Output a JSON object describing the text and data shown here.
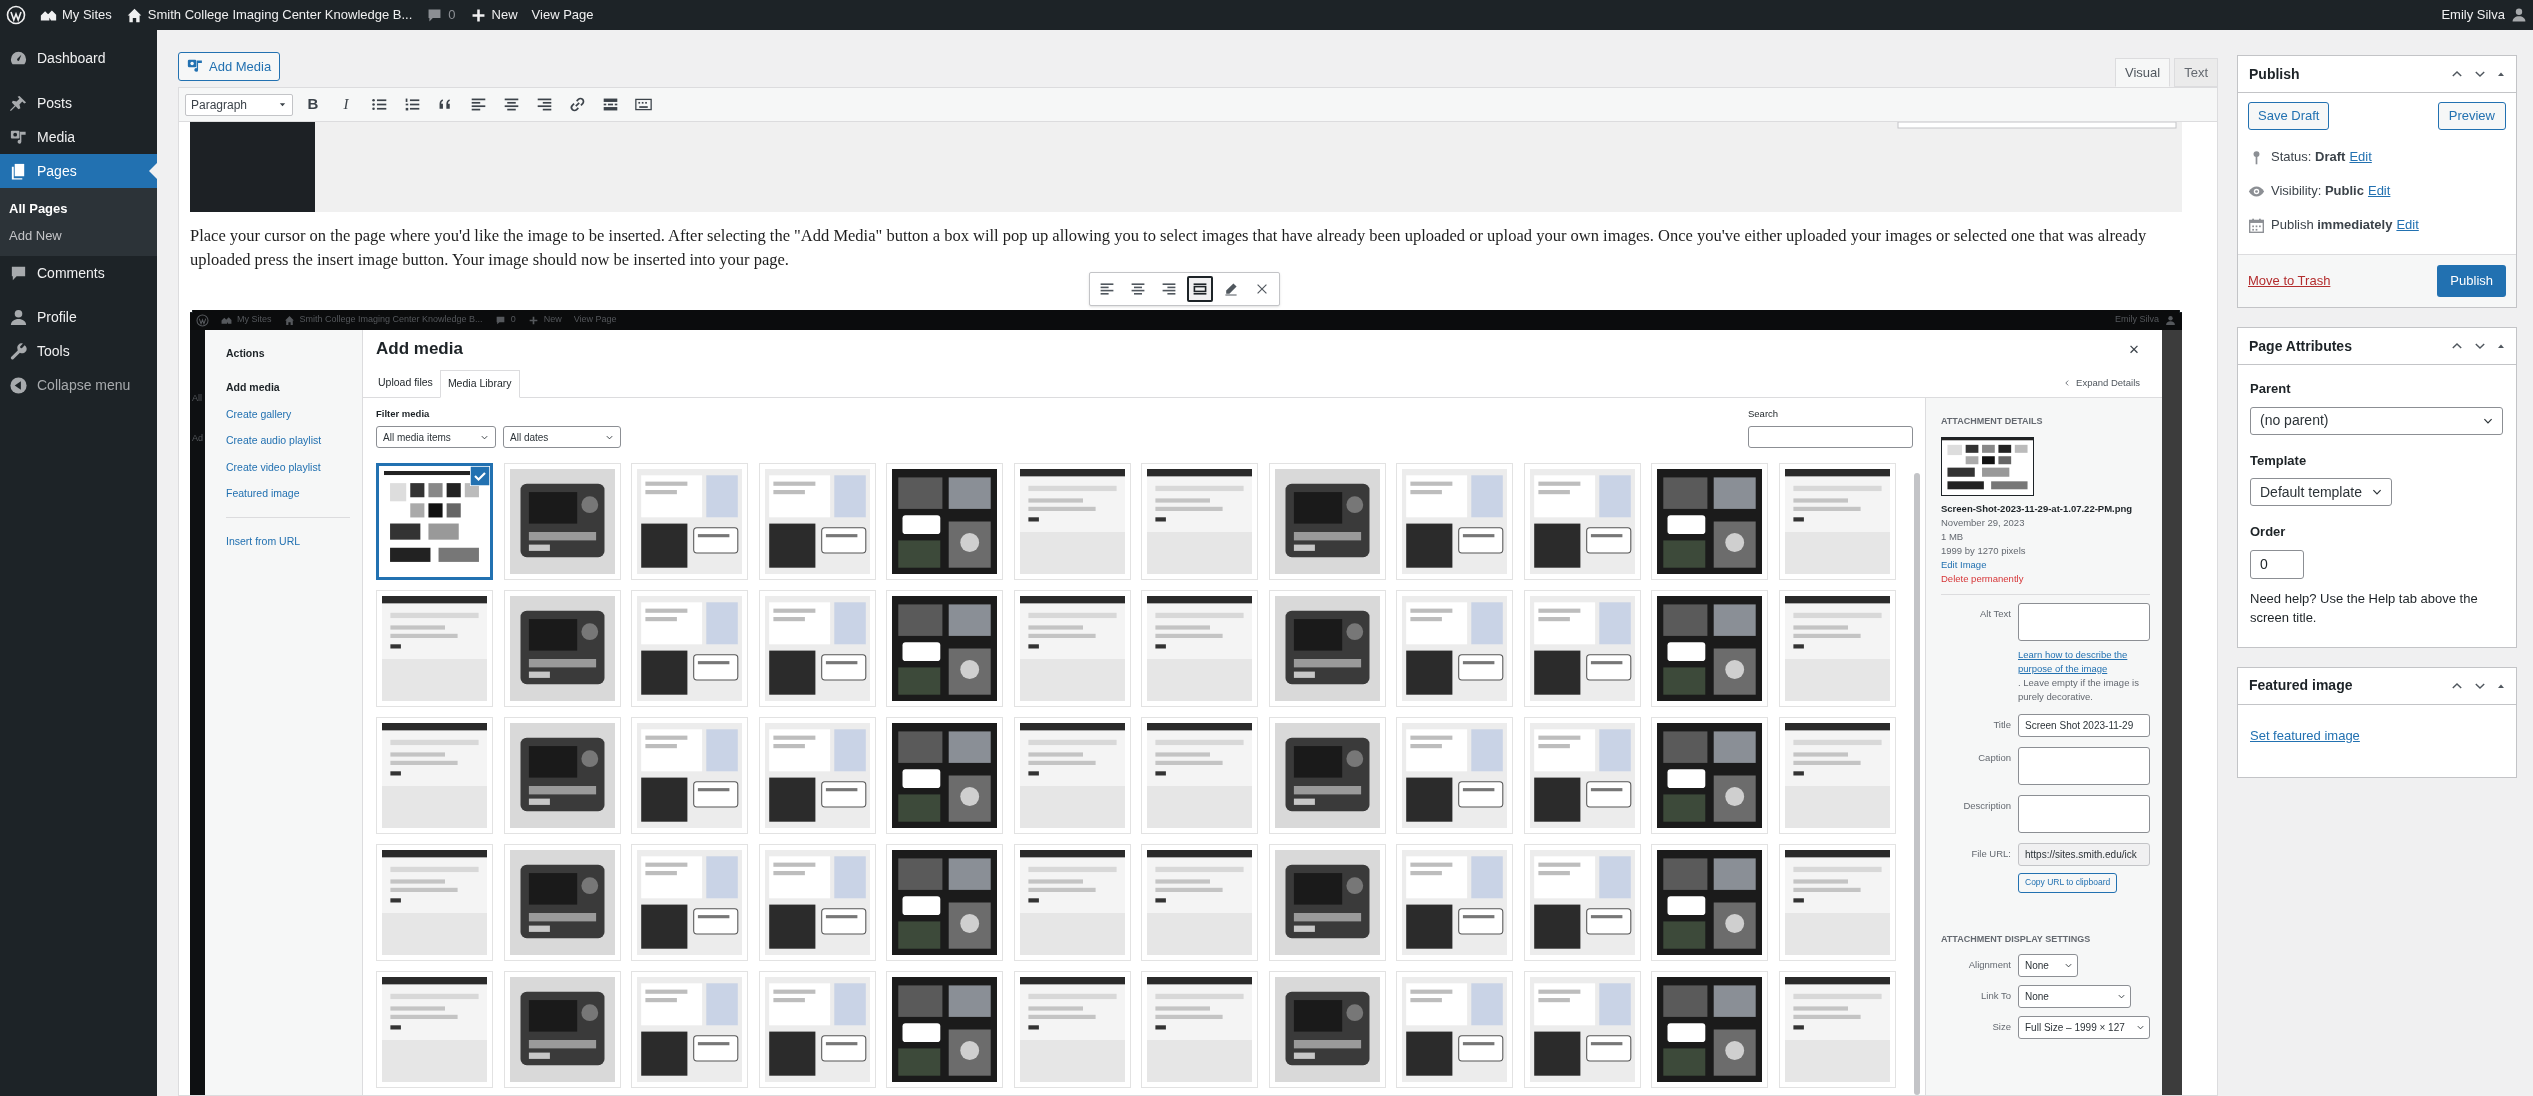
{
  "admin_bar": {
    "items": [
      {
        "kind": "sites",
        "label": "My Sites"
      },
      {
        "kind": "site",
        "label": "Smith College Imaging Center Knowledge B..."
      },
      {
        "kind": "comments",
        "label": "0"
      },
      {
        "kind": "new",
        "label": "New"
      },
      {
        "kind": "view",
        "label": "View Page"
      }
    ],
    "user": "Emily Silva"
  },
  "sidebar": {
    "items": [
      {
        "kind": "dashboard",
        "label": "Dashboard",
        "selected": false
      },
      {
        "kind": "posts",
        "label": "Posts",
        "selected": false
      },
      {
        "kind": "media",
        "label": "Media",
        "selected": false
      },
      {
        "kind": "pages",
        "label": "Pages",
        "selected": true,
        "children": [
          {
            "label": "All Pages",
            "selected": true
          },
          {
            "label": "Add New",
            "selected": false
          }
        ]
      },
      {
        "kind": "comments",
        "label": "Comments",
        "selected": false
      },
      {
        "kind": "profile",
        "label": "Profile",
        "selected": false
      },
      {
        "kind": "tools",
        "label": "Tools",
        "selected": false
      },
      {
        "kind": "collapse",
        "label": "Collapse menu",
        "selected": false
      }
    ]
  },
  "editor": {
    "add_media": "Add Media",
    "tabs": [
      {
        "label": "Visual",
        "selected": true
      },
      {
        "label": "Text",
        "selected": false
      }
    ],
    "format": "Paragraph",
    "toolbar": [
      {
        "kind": "bold",
        "label": "B"
      },
      {
        "kind": "italic",
        "label": "I"
      },
      {
        "kind": "bullets"
      },
      {
        "kind": "numbers"
      },
      {
        "kind": "quote"
      },
      {
        "kind": "align-left"
      },
      {
        "kind": "align-center"
      },
      {
        "kind": "align-right"
      },
      {
        "kind": "link"
      },
      {
        "kind": "more"
      },
      {
        "kind": "keyboard"
      }
    ],
    "paragraph": "Place your cursor on the page where you'd like the image to be inserted. After selecting the \"Add Media\" button a box will pop up allowing you to select images that have already been uploaded or upload your own images. Once you've either uploaded your images or selected one that was already uploaded press the insert image button. Your image should now be inserted into your page.",
    "image_toolbar": [
      {
        "kind": "align-left",
        "selected": false
      },
      {
        "kind": "align-center",
        "selected": false
      },
      {
        "kind": "align-right",
        "selected": false
      },
      {
        "kind": "align-none",
        "selected": true
      },
      {
        "kind": "edit",
        "selected": false
      },
      {
        "kind": "remove",
        "selected": false
      }
    ]
  },
  "embedded": {
    "admin_bar": {
      "items": [
        {
          "kind": "sites",
          "label": "My Sites"
        },
        {
          "kind": "site",
          "label": "Smith College Imaging Center Knowledge B..."
        },
        {
          "kind": "comments",
          "label": "0"
        },
        {
          "kind": "new",
          "label": "New"
        },
        {
          "kind": "view",
          "label": "View Page"
        }
      ],
      "user": "Emily Silva"
    },
    "sidebar_fragments": [
      "All",
      "Ad"
    ],
    "modal": {
      "menu_title": "Actions",
      "menu": [
        {
          "label": "Add media",
          "selected": true
        },
        {
          "label": "Create gallery",
          "selected": false
        },
        {
          "label": "Create audio playlist",
          "selected": false
        },
        {
          "label": "Create video playlist",
          "selected": false
        },
        {
          "label": "Featured image",
          "selected": false
        }
      ],
      "extra_menu": [
        {
          "label": "Insert from URL",
          "selected": false
        }
      ],
      "title": "Add media",
      "tabs": [
        {
          "label": "Upload files",
          "selected": false
        },
        {
          "label": "Media Library",
          "selected": true
        }
      ],
      "expand_details": "Expand Details",
      "filter_label": "Filter media",
      "filters": [
        "All media items",
        "All dates"
      ],
      "search_label": "Search",
      "thumbnails": [
        {
          "selected": true
        },
        {
          "selected": false
        },
        {
          "selected": false
        },
        {
          "selected": false
        },
        {
          "selected": false
        },
        {
          "selected": false
        },
        {
          "selected": false
        },
        {
          "selected": false
        },
        {
          "selected": false
        },
        {
          "selected": false
        },
        {
          "selected": false
        },
        {
          "selected": false
        },
        {
          "selected": false
        },
        {
          "selected": false
        },
        {
          "selected": false
        },
        {
          "selected": false
        },
        {
          "selected": false
        },
        {
          "selected": false
        },
        {
          "selected": false
        },
        {
          "selected": false
        },
        {
          "selected": false
        },
        {
          "selected": false
        },
        {
          "selected": false
        },
        {
          "selected": false
        },
        {
          "selected": false
        },
        {
          "selected": false
        },
        {
          "selected": false
        },
        {
          "selected": false
        },
        {
          "selected": false
        },
        {
          "selected": false
        },
        {
          "selected": false
        },
        {
          "selected": false
        },
        {
          "selected": false
        },
        {
          "selected": false
        },
        {
          "selected": false
        },
        {
          "selected": false
        },
        {
          "selected": false
        },
        {
          "selected": false
        },
        {
          "selected": false
        },
        {
          "selected": false
        },
        {
          "selected": false
        },
        {
          "selected": false
        },
        {
          "selected": false
        },
        {
          "selected": false
        },
        {
          "selected": false
        },
        {
          "selected": false
        },
        {
          "selected": false
        },
        {
          "selected": false
        },
        {
          "selected": false
        },
        {
          "selected": false
        },
        {
          "selected": false
        },
        {
          "selected": false
        },
        {
          "selected": false
        },
        {
          "selected": false
        },
        {
          "selected": false
        },
        {
          "selected": false
        },
        {
          "selected": false
        },
        {
          "selected": false
        },
        {
          "selected": false
        },
        {
          "selected": false
        }
      ],
      "details": {
        "heading": "ATTACHMENT DETAILS",
        "filename": "Screen-Shot-2023-11-29-at-1.07.22-PM.png",
        "date": "November 29, 2023",
        "size": "1 MB",
        "dimensions": "1999 by 1270 pixels",
        "edit": "Edit Image",
        "delete": "Delete permanently",
        "fields": [
          {
            "kind": "textarea",
            "label": "Alt Text",
            "help_link": "Learn how to describe the purpose of the image",
            "help": ". Leave empty if the image is purely decorative."
          },
          {
            "kind": "input",
            "label": "Title",
            "value": "Screen Shot 2023-11-29"
          },
          {
            "kind": "textarea",
            "label": "Caption"
          },
          {
            "kind": "textarea",
            "label": "Description"
          },
          {
            "kind": "url",
            "label": "File URL:",
            "value": "https://sites.smith.edu/ick",
            "button": "Copy URL to clipboard"
          }
        ],
        "display_heading": "ATTACHMENT DISPLAY SETTINGS",
        "display": [
          {
            "label": "Alignment",
            "value": "None"
          },
          {
            "label": "Link To",
            "value": "None"
          },
          {
            "label": "Size",
            "value": "Full Size – 1999 × 127"
          }
        ]
      }
    }
  },
  "publish": {
    "title": "Publish",
    "save_draft": "Save Draft",
    "preview": "Preview",
    "rows": [
      {
        "kind": "status",
        "text": "Status: **Draft**",
        "link": "Edit"
      },
      {
        "kind": "visibility",
        "text": "Visibility: **Public**",
        "link": "Edit"
      },
      {
        "kind": "schedule",
        "text": "Publish **immediately**",
        "link": "Edit"
      }
    ],
    "trash": "Move to Trash",
    "publish": "Publish"
  },
  "page_attributes": {
    "title": "Page Attributes",
    "parent_label": "Parent",
    "parent": "(no parent)",
    "template_label": "Template",
    "template": "Default template",
    "order_label": "Order",
    "order": "0",
    "help": "Need help? Use the Help tab above the screen title."
  },
  "featured_image": {
    "title": "Featured image",
    "link": "Set featured image"
  }
}
